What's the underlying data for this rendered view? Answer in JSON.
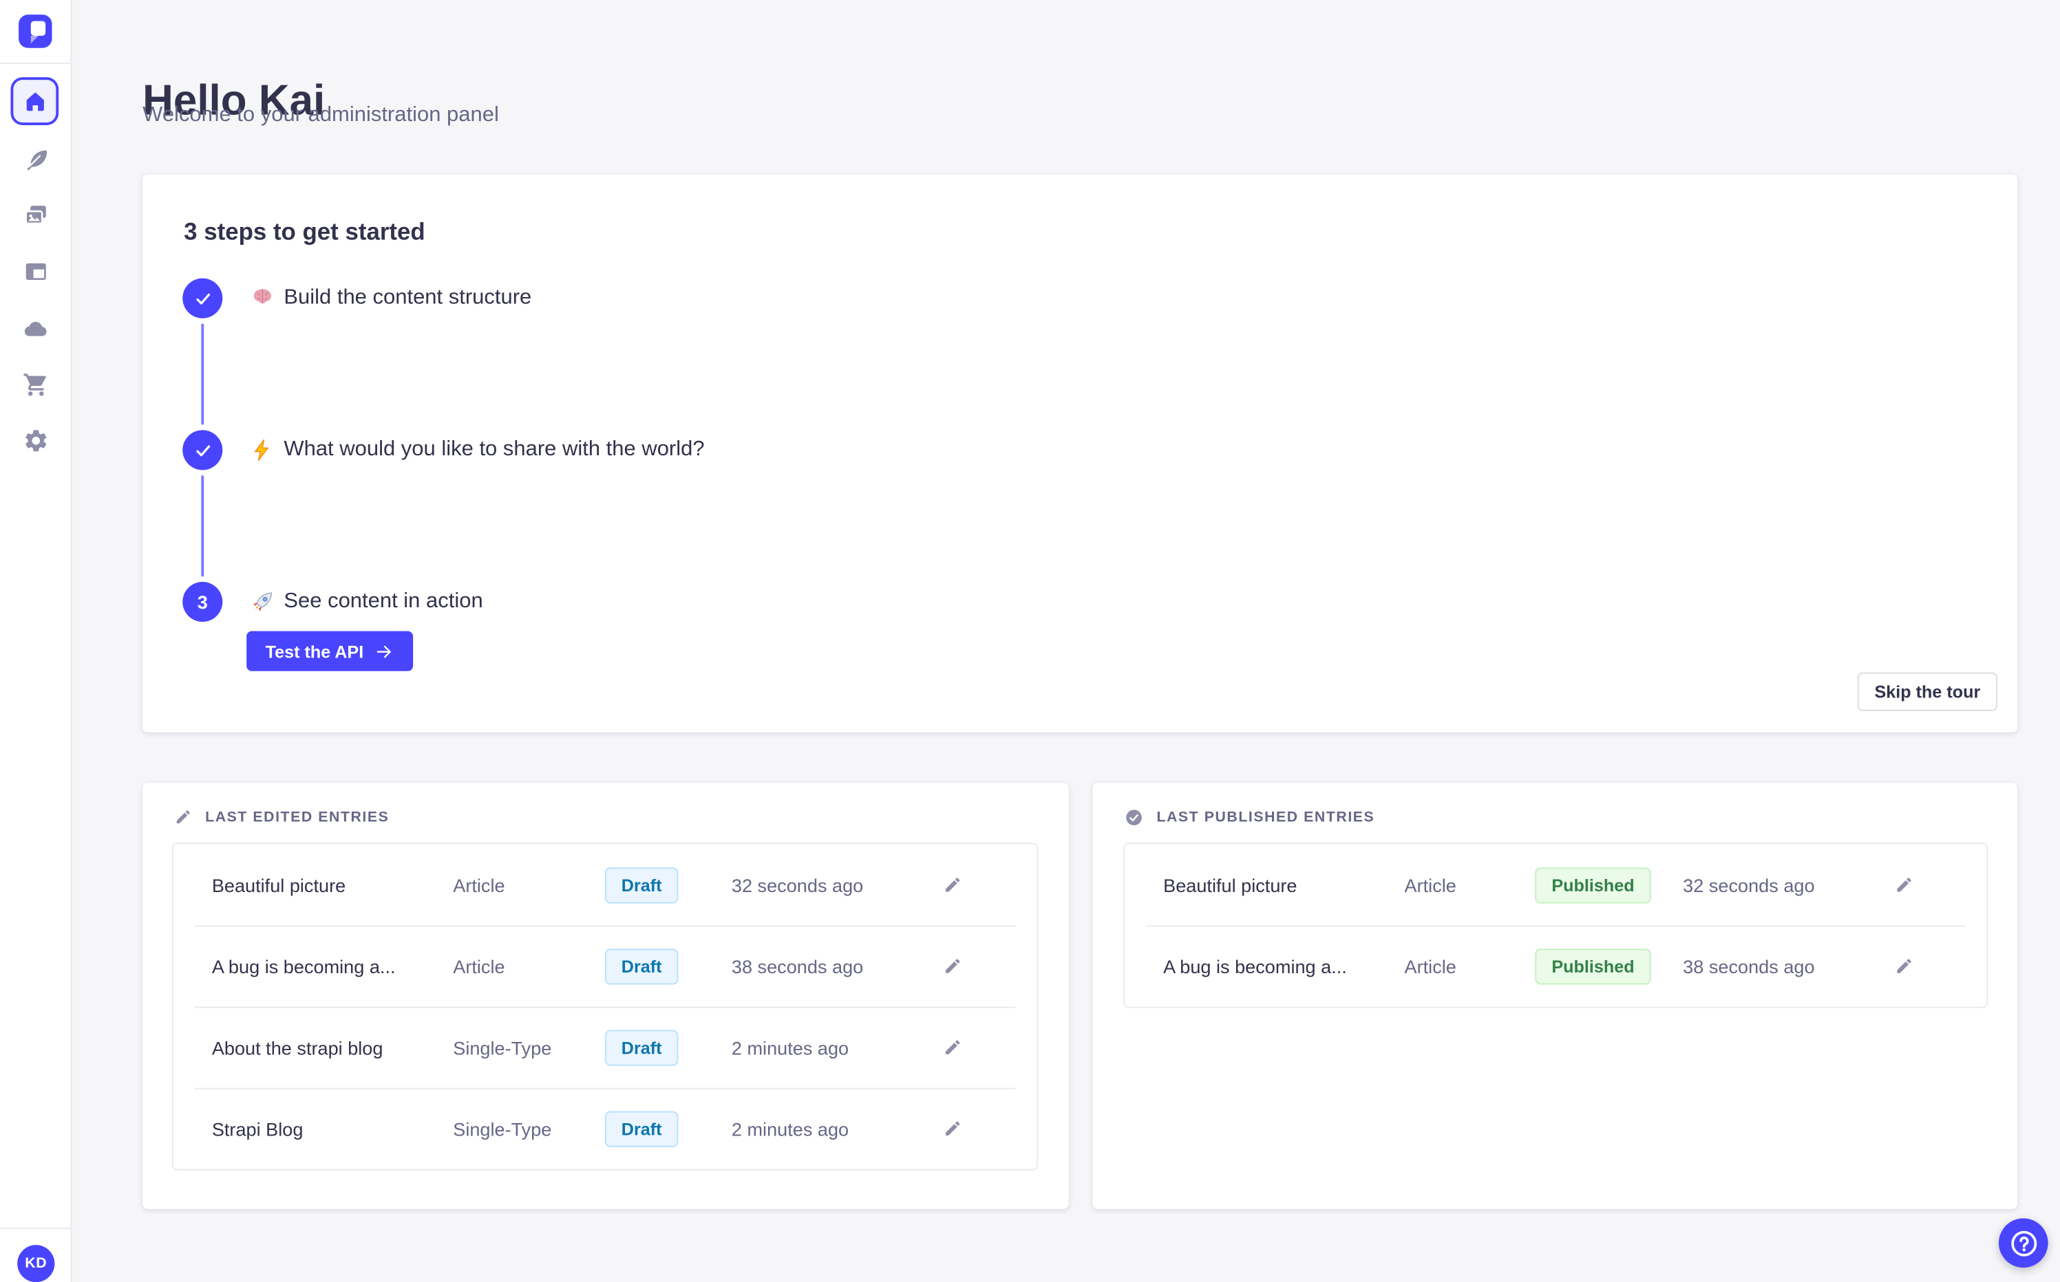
{
  "colors": {
    "primary": "#4945FF",
    "primary_light": "#7B79FF",
    "page_bg": "#F6F6F9",
    "card_bg": "#FFFFFF",
    "border": "#EAEAEF",
    "text": "#32324D",
    "text_muted": "#666687",
    "icon_gray": "#8E8EA9",
    "draft_bg": "#EAF5FF",
    "draft_border": "#B8E1FF",
    "draft_text": "#0C75AF",
    "published_bg": "#EAFBE7",
    "published_border": "#C6F0C2",
    "published_text": "#328048"
  },
  "sidebar": {
    "logo_icon": "strapi-logo",
    "nav_icons": [
      "home-icon",
      "feather-icon",
      "media-library-icon",
      "content-type-builder-icon",
      "cloud-icon",
      "marketplace-cart-icon",
      "settings-gear-icon"
    ],
    "active_item": "home",
    "avatar_initials": "KD"
  },
  "header": {
    "title": "Hello Kai",
    "subtitle": "Welcome to your administration panel"
  },
  "onboarding": {
    "title": "3 steps to get started",
    "steps": [
      {
        "state": "done",
        "icon": "brain-emoji",
        "label": "Build the content structure"
      },
      {
        "state": "done",
        "icon": "lightning-emoji",
        "label": "What would you like to share with the world?"
      },
      {
        "state": "active",
        "number": "3",
        "icon": "rocket-emoji",
        "label": "See content in action"
      }
    ],
    "cta_label": "Test the API",
    "cta_icon": "arrow-right-icon",
    "skip_label": "Skip the tour"
  },
  "panels": {
    "edited": {
      "title": "LAST EDITED ENTRIES",
      "icon": "pencil-icon",
      "rows": [
        {
          "title": "Beautiful picture",
          "type": "Article",
          "status": "Draft",
          "time": "32 seconds ago"
        },
        {
          "title": "A bug is becoming a...",
          "type": "Article",
          "status": "Draft",
          "time": "38 seconds ago"
        },
        {
          "title": "About the strapi blog",
          "type": "Single-Type",
          "status": "Draft",
          "time": "2 minutes ago"
        },
        {
          "title": "Strapi Blog",
          "type": "Single-Type",
          "status": "Draft",
          "time": "2 minutes ago"
        }
      ]
    },
    "published": {
      "title": "LAST PUBLISHED ENTRIES",
      "icon": "check-circle-icon",
      "rows": [
        {
          "title": "Beautiful picture",
          "type": "Article",
          "status": "Published",
          "time": "32 seconds ago"
        },
        {
          "title": "A bug is becoming a...",
          "type": "Article",
          "status": "Published",
          "time": "38 seconds ago"
        }
      ]
    }
  },
  "help": {
    "icon": "question-help-icon"
  }
}
